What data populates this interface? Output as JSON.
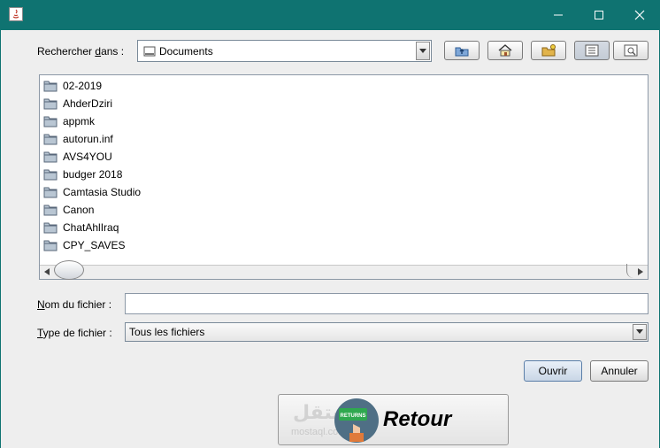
{
  "window": {
    "title": "",
    "controls": {
      "minimize": "minimize-icon",
      "maximize": "maximize-icon",
      "close": "close-icon"
    },
    "title_bar_color": "#0f7371"
  },
  "look_in": {
    "label_prefix": "Rechercher ",
    "label_mnemonic": "d",
    "label_suffix": "ans :",
    "selected": "Documents"
  },
  "toolbar": {
    "buttons": [
      "up-folder-icon",
      "home-icon",
      "new-folder-icon",
      "list-view-icon",
      "details-view-icon"
    ]
  },
  "files": [
    "02-2019",
    "AhderDziri",
    "appmk",
    "autorun.inf",
    "AVS4YOU",
    "budger 2018",
    "Camtasia Studio",
    "Canon",
    "ChatAhlIraq",
    "CPY_SAVES"
  ],
  "filename": {
    "label_mnemonic": "N",
    "label_rest": "om du fichier :",
    "value": ""
  },
  "filetype": {
    "label_mnemonic": "T",
    "label_rest": "ype de fichier :",
    "selected": "Tous les fichiers"
  },
  "actions": {
    "open": "Ouvrir",
    "cancel": "Annuler"
  },
  "retour": {
    "label": "Retour",
    "watermark": "مستقل",
    "watermark_sub": "mostaql.com",
    "icon_text": "RETURNS"
  }
}
